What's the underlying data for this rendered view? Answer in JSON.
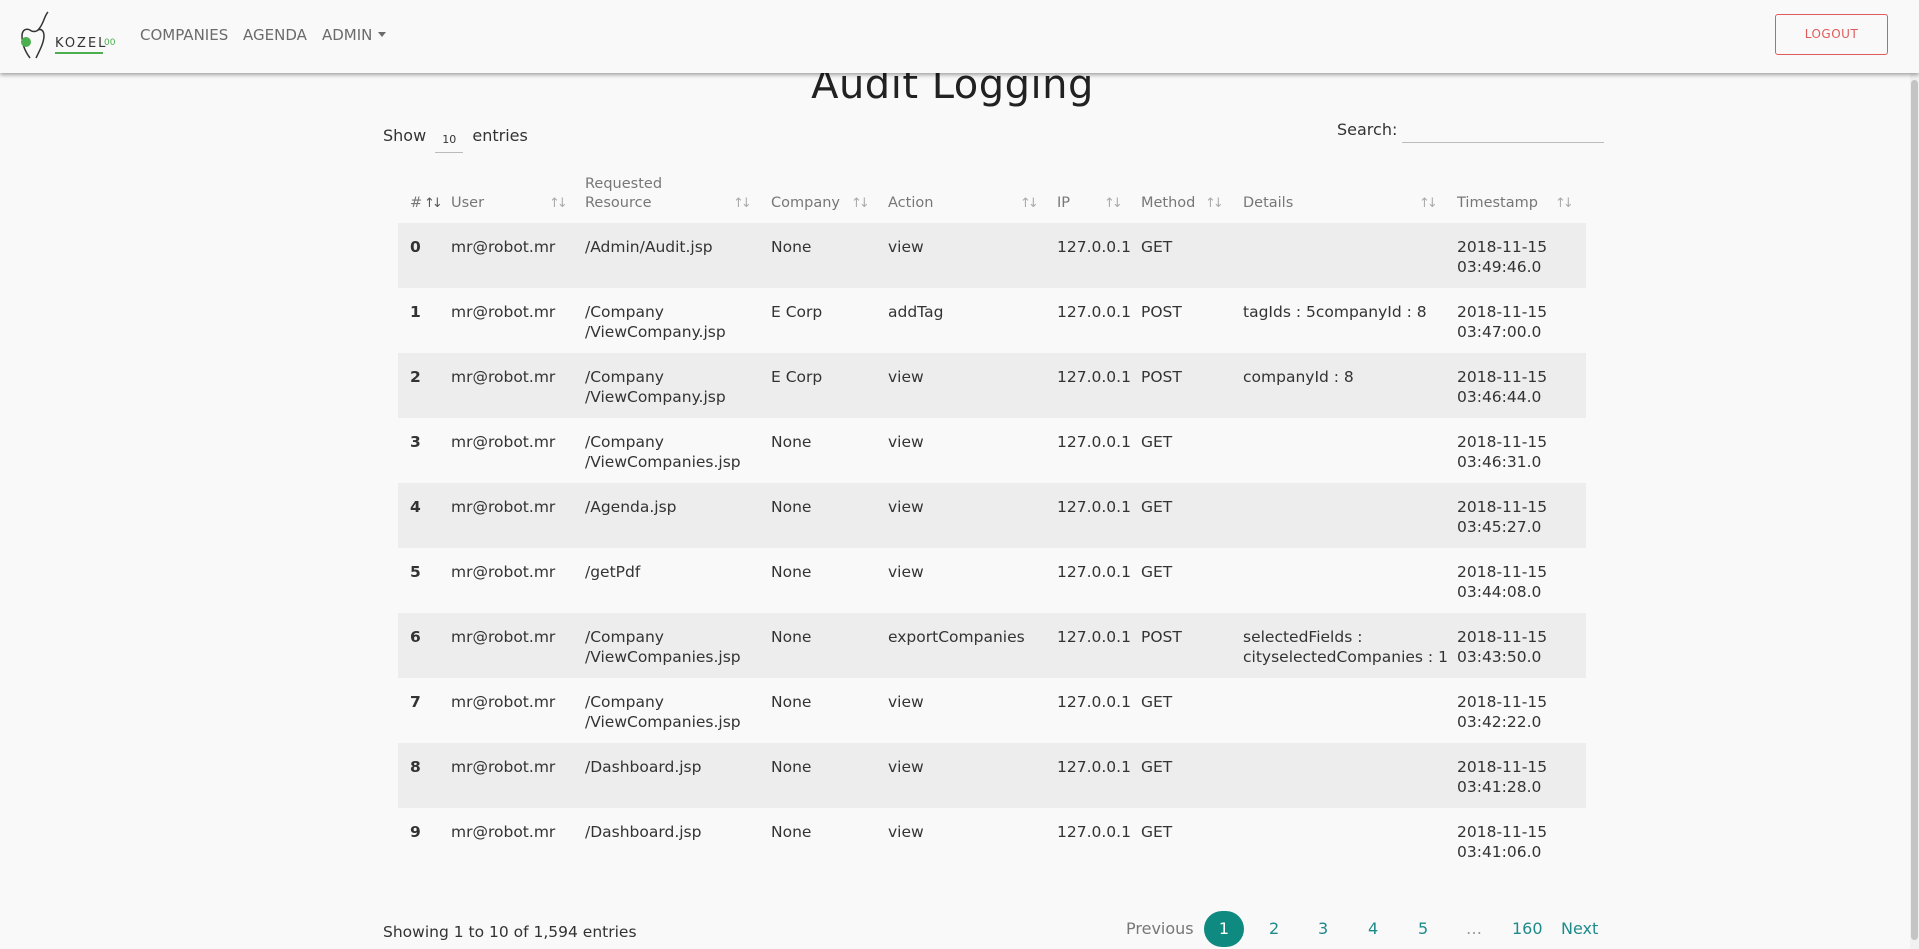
{
  "nav": {
    "logo_text": "KOZEL",
    "logo_sup": "00",
    "companies": "COMPANIES",
    "agenda": "AGENDA",
    "admin": "ADMIN",
    "logout": "LOGOUT"
  },
  "page": {
    "title": "Audit Logging",
    "show_label": "Show",
    "entries_count": "10",
    "entries_label": "entries",
    "search_label": "Search:",
    "search_value": ""
  },
  "table": {
    "headers": [
      "#",
      "User",
      "Requested Resource",
      "Company",
      "Action",
      "IP",
      "Method",
      "Details",
      "Timestamp"
    ],
    "rows": [
      {
        "idx": "0",
        "user": "mr@robot.mr",
        "resource": "/Admin/Audit.jsp",
        "company": "None",
        "action": "view",
        "ip": "127.0.0.1",
        "method": "GET",
        "details": "",
        "ts_date": "2018-11-15",
        "ts_time": "03:49:46.0"
      },
      {
        "idx": "1",
        "user": "mr@robot.mr",
        "resource": "/Company /ViewCompany.jsp",
        "company": "E Corp",
        "action": "addTag",
        "ip": "127.0.0.1",
        "method": "POST",
        "details": "tagIds : 5companyId : 8",
        "ts_date": "2018-11-15",
        "ts_time": "03:47:00.0"
      },
      {
        "idx": "2",
        "user": "mr@robot.mr",
        "resource": "/Company /ViewCompany.jsp",
        "company": "E Corp",
        "action": "view",
        "ip": "127.0.0.1",
        "method": "POST",
        "details": "companyId : 8",
        "ts_date": "2018-11-15",
        "ts_time": "03:46:44.0"
      },
      {
        "idx": "3",
        "user": "mr@robot.mr",
        "resource": "/Company /ViewCompanies.jsp",
        "company": "None",
        "action": "view",
        "ip": "127.0.0.1",
        "method": "GET",
        "details": "",
        "ts_date": "2018-11-15",
        "ts_time": "03:46:31.0"
      },
      {
        "idx": "4",
        "user": "mr@robot.mr",
        "resource": "/Agenda.jsp",
        "company": "None",
        "action": "view",
        "ip": "127.0.0.1",
        "method": "GET",
        "details": "",
        "ts_date": "2018-11-15",
        "ts_time": "03:45:27.0"
      },
      {
        "idx": "5",
        "user": "mr@robot.mr",
        "resource": "/getPdf",
        "company": "None",
        "action": "view",
        "ip": "127.0.0.1",
        "method": "GET",
        "details": "",
        "ts_date": "2018-11-15",
        "ts_time": "03:44:08.0"
      },
      {
        "idx": "6",
        "user": "mr@robot.mr",
        "resource": "/Company /ViewCompanies.jsp",
        "company": "None",
        "action": "exportCompanies",
        "ip": "127.0.0.1",
        "method": "POST",
        "details": "selectedFields : cityselectedCompanies : 1",
        "ts_date": "2018-11-15",
        "ts_time": "03:43:50.0"
      },
      {
        "idx": "7",
        "user": "mr@robot.mr",
        "resource": "/Company /ViewCompanies.jsp",
        "company": "None",
        "action": "view",
        "ip": "127.0.0.1",
        "method": "GET",
        "details": "",
        "ts_date": "2018-11-15",
        "ts_time": "03:42:22.0"
      },
      {
        "idx": "8",
        "user": "mr@robot.mr",
        "resource": "/Dashboard.jsp",
        "company": "None",
        "action": "view",
        "ip": "127.0.0.1",
        "method": "GET",
        "details": "",
        "ts_date": "2018-11-15",
        "ts_time": "03:41:28.0"
      },
      {
        "idx": "9",
        "user": "mr@robot.mr",
        "resource": "/Dashboard.jsp",
        "company": "None",
        "action": "view",
        "ip": "127.0.0.1",
        "method": "GET",
        "details": "",
        "ts_date": "2018-11-15",
        "ts_time": "03:41:06.0"
      }
    ]
  },
  "footer": {
    "info": "Showing 1 to 10 of 1,594 entries",
    "previous": "Previous",
    "pages": [
      "1",
      "2",
      "3",
      "4",
      "5",
      "…",
      "160"
    ],
    "next": "Next"
  },
  "colors": {
    "accent": "#0f8a80",
    "logout": "#e05b5b",
    "logo_green": "#4caf50"
  }
}
